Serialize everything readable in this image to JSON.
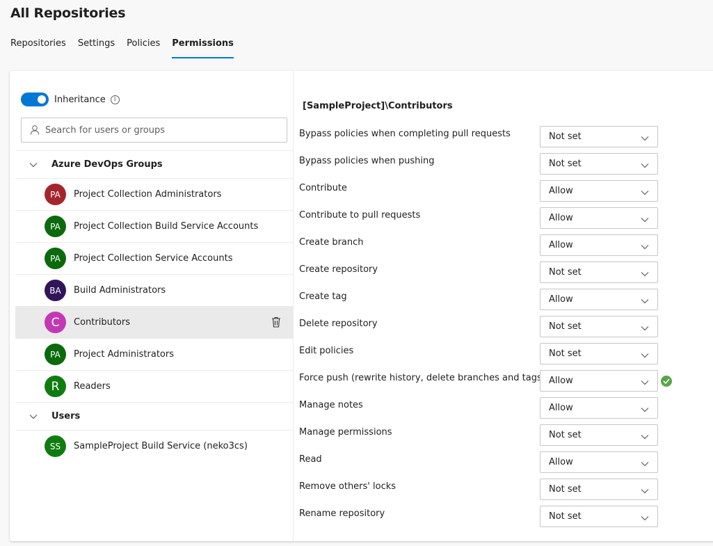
{
  "title": "All Repositories",
  "tabs": [
    "Repositories",
    "Settings",
    "Policies",
    "Permissions"
  ],
  "active_tab": "Permissions",
  "inheritance": {
    "label": "Inheritance",
    "enabled": true
  },
  "search": {
    "placeholder": "Search for users or groups"
  },
  "groups": [
    {
      "name": "Azure DevOps Groups",
      "items": [
        {
          "initials": "PA",
          "name": "Project Collection Administrators",
          "color": "#a4262c"
        },
        {
          "initials": "PA",
          "name": "Project Collection Build Service Accounts",
          "color": "#0b6a0b"
        },
        {
          "initials": "PA",
          "name": "Project Collection Service Accounts",
          "color": "#0b6a0b"
        },
        {
          "initials": "BA",
          "name": "Build Administrators",
          "color": "#32145a"
        },
        {
          "initials": "C",
          "name": "Contributors",
          "color": "#c239b3",
          "selected": true
        },
        {
          "initials": "PA",
          "name": "Project Administrators",
          "color": "#0b6a0b"
        },
        {
          "initials": "R",
          "name": "Readers",
          "color": "#107c10"
        }
      ]
    },
    {
      "name": "Users",
      "items": [
        {
          "initials": "SS",
          "name": "SampleProject Build Service (neko3cs)",
          "color": "#107c10"
        }
      ]
    }
  ],
  "permissions_title": "[SampleProject]\\Contributors",
  "permissions": [
    {
      "label": "Bypass policies when completing pull requests",
      "value": "Not set"
    },
    {
      "label": "Bypass policies when pushing",
      "value": "Not set"
    },
    {
      "label": "Contribute",
      "value": "Allow"
    },
    {
      "label": "Contribute to pull requests",
      "value": "Allow"
    },
    {
      "label": "Create branch",
      "value": "Allow"
    },
    {
      "label": "Create repository",
      "value": "Not set"
    },
    {
      "label": "Create tag",
      "value": "Allow"
    },
    {
      "label": "Delete repository",
      "value": "Not set"
    },
    {
      "label": "Edit policies",
      "value": "Not set"
    },
    {
      "label": "Force push (rewrite history, delete branches and tags)",
      "value": "Allow",
      "saved": true
    },
    {
      "label": "Manage notes",
      "value": "Allow"
    },
    {
      "label": "Manage permissions",
      "value": "Not set"
    },
    {
      "label": "Read",
      "value": "Allow"
    },
    {
      "label": "Remove others' locks",
      "value": "Not set"
    },
    {
      "label": "Rename repository",
      "value": "Not set"
    }
  ],
  "colors": {
    "accent": "#0078d4",
    "success": "#57a64a"
  },
  "icons": {
    "search": "person-search-icon",
    "delete": "trash-icon",
    "saved": "check-circle-icon"
  }
}
